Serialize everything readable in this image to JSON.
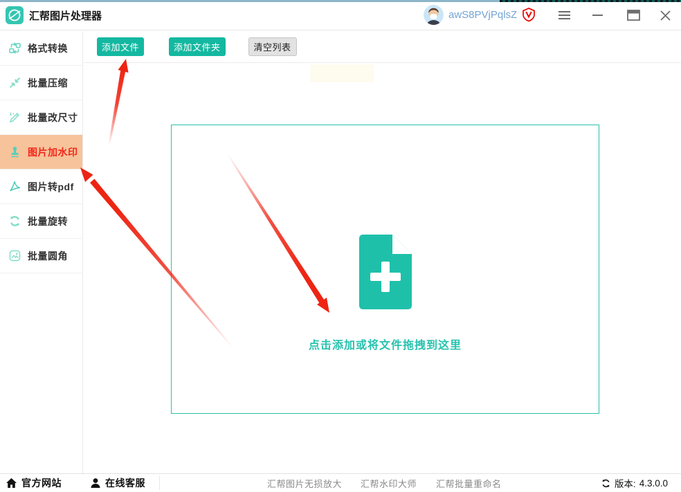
{
  "titlebar": {
    "app_title": "汇帮图片处理器",
    "username": "awS8PVjPqlsZ"
  },
  "sidebar": {
    "items": [
      {
        "label": "格式转换",
        "icon": "format-convert-icon",
        "active": false
      },
      {
        "label": "批量压缩",
        "icon": "compress-icon",
        "active": false
      },
      {
        "label": "批量改尺寸",
        "icon": "resize-icon",
        "active": false
      },
      {
        "label": "图片加水印",
        "icon": "stamp-icon",
        "active": true
      },
      {
        "label": "图片转pdf",
        "icon": "pdf-icon",
        "active": false
      },
      {
        "label": "批量旋转",
        "icon": "rotate-icon",
        "active": false
      },
      {
        "label": "批量圆角",
        "icon": "rounded-image-icon",
        "active": false
      }
    ]
  },
  "toolbar": {
    "add_files": "添加文件",
    "add_folder": "添加文件夹",
    "clear_list": "清空列表"
  },
  "dropzone": {
    "hint": "点击添加或将文件拖拽到这里",
    "icon": "add-document-icon"
  },
  "footer": {
    "official_site": "官方网站",
    "online_service": "在线客服",
    "links": [
      "汇帮图片无损放大",
      "汇帮水印大师",
      "汇帮批量重命名"
    ],
    "version_label": "版本:",
    "version": "4.3.0.0"
  },
  "colors": {
    "teal_button": "#14b8a0",
    "dropzone_border": "#2bbfac",
    "dropzone_text": "#27c2ae",
    "active_item_bg": "#f6c39a",
    "active_item_text": "#f3261a",
    "username_text": "#74a3d4",
    "annotation_arrow": "#ee2413"
  }
}
